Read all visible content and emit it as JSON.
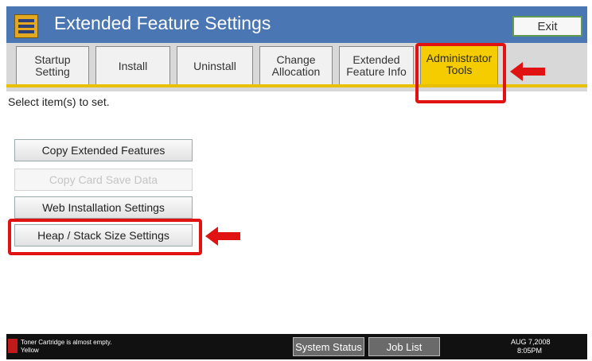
{
  "header": {
    "title": "Extended Feature Settings",
    "icon": "extended-feature-settings-icon",
    "exit_label": "Exit"
  },
  "tabs": [
    {
      "label": "Startup\nSetting",
      "active": false
    },
    {
      "label": "Install",
      "active": false
    },
    {
      "label": "Uninstall",
      "active": false
    },
    {
      "label": "Change\nAllocation",
      "active": false
    },
    {
      "label": "Extended\nFeature Info",
      "active": false
    },
    {
      "label": "Administrator\nTools",
      "active": true
    }
  ],
  "instruction": "Select item(s) to set.",
  "buttons": [
    {
      "label": "Copy Extended Features",
      "enabled": true
    },
    {
      "label": "Copy Card Save Data",
      "enabled": false
    },
    {
      "label": "Web Installation Settings",
      "enabled": true
    },
    {
      "label": "Heap / Stack Size Settings",
      "enabled": true
    }
  ],
  "status_bar": {
    "toner_message": "Toner Cartridge is almost empty.\nYellow",
    "system_status_label": "System Status",
    "job_list_label": "Job List",
    "date": "AUG   7,2008",
    "time": "8:05PM"
  },
  "colors": {
    "header_blue": "#4a76b4",
    "active_tab_yellow": "#f5cc00",
    "highlight_red": "#e01212"
  }
}
